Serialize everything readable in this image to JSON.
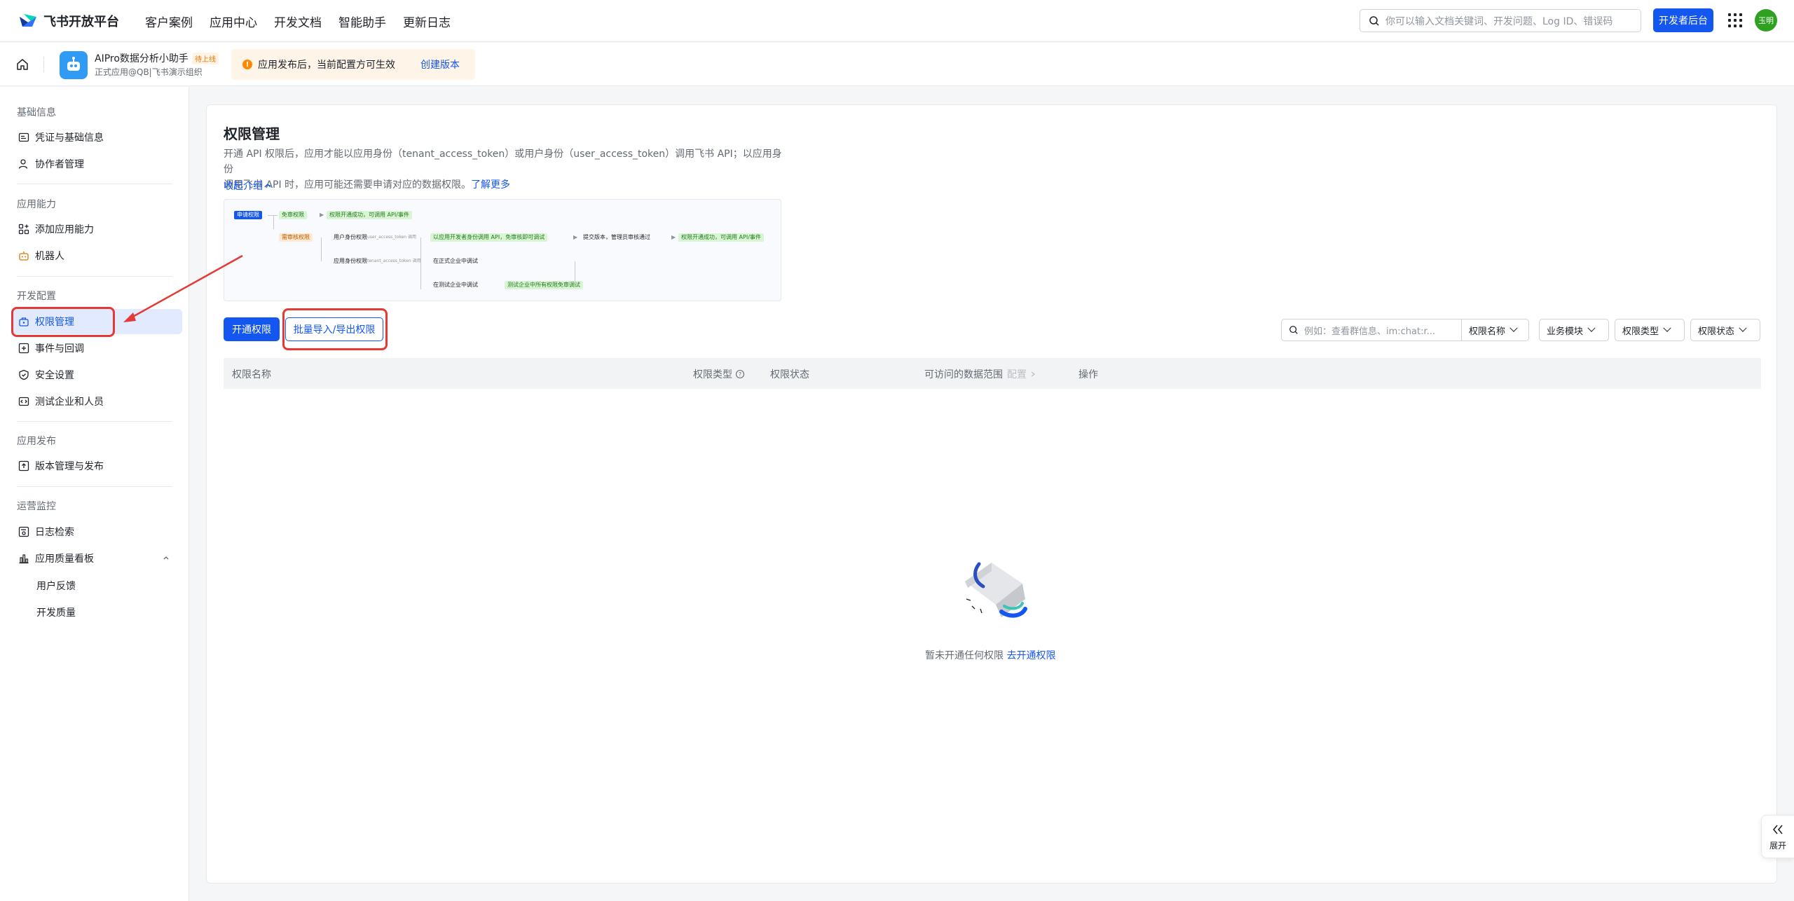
{
  "topnav": {
    "brand": "飞书开放平台",
    "items": [
      "客户案例",
      "应用中心",
      "开发文档",
      "智能助手",
      "更新日志"
    ],
    "search_placeholder": "你可以输入文档关键词、开发问题、Log ID、错误码",
    "dev_button": "开发者后台",
    "avatar_text": "玉明"
  },
  "appbar": {
    "app_name": "AIPro数据分析小助手",
    "app_badge": "待上线",
    "app_sub": "正式应用@QB|飞书演示组织",
    "notice_text": "应用发布后，当前配置方可生效",
    "notice_link": "创建版本"
  },
  "sidebar": {
    "sections": [
      {
        "title": "基础信息",
        "items": [
          "凭证与基础信息",
          "协作者管理"
        ]
      },
      {
        "title": "应用能力",
        "items": [
          "添加应用能力",
          "机器人"
        ]
      },
      {
        "title": "开发配置",
        "items": [
          "权限管理",
          "事件与回调",
          "安全设置",
          "测试企业和人员"
        ]
      },
      {
        "title": "应用发布",
        "items": [
          "版本管理与发布"
        ]
      },
      {
        "title": "运营监控",
        "items": [
          "日志检索",
          "应用质量看板"
        ]
      }
    ],
    "sub_items": [
      "用户反馈",
      "开发质量"
    ],
    "active": "权限管理"
  },
  "main": {
    "title": "权限管理",
    "desc_line1": "开通 API 权限后，应用才能以应用身份（tenant_access_token）或用户身份（user_access_token）调用飞书 API；以应用身份",
    "desc_line2": "调用飞书 API 时，应用可能还需要申请对应的数据权限。",
    "learn_more": "了解更多",
    "collapse": "收起介绍",
    "flow": {
      "apply": "申请权限",
      "free": "免审权限",
      "success1": "权限开通成功，可调用 API/事件",
      "review": "需审核权限",
      "user_perm": "用户身份权限",
      "user_token": "user_access_token 调用",
      "app_perm": "应用身份权限",
      "tenant_token": "tenant_access_token 调用",
      "dev_call": "以应用开发者身份调用 API，免审核即可调试",
      "submit": "提交版本，管理员审核通过",
      "success2": "权限开通成功，可调用 API/事件",
      "formal": "在正式企业中调试",
      "test": "在测试企业中调试",
      "test_tip": "测试企业中所有权限免审调试"
    },
    "btn_open": "开通权限",
    "btn_batch": "批量导入/导出权限",
    "filter_placeholder": "例如：查看群信息、im:chat:r...",
    "filters": [
      "权限名称",
      "业务模块",
      "权限类型",
      "权限状态"
    ],
    "columns": [
      "权限名称",
      "权限类型",
      "权限状态",
      "可访问的数据范围",
      "配置",
      "操作"
    ],
    "empty_text": "暂未开通任何权限",
    "empty_link": "去开通权限",
    "expand": "展开"
  },
  "colors": {
    "accent": "#1456f0",
    "highlight": "#e53935"
  }
}
